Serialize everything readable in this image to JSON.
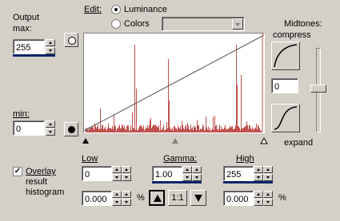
{
  "output": {
    "title_line1": "Output",
    "title_line2": "max:",
    "max_value": "255",
    "min_label": "min:",
    "min_value": "0"
  },
  "edit": {
    "label": "Edit:",
    "options": [
      "Luminance",
      "Colors"
    ],
    "selected": "Luminance",
    "colors_dropdown_value": ""
  },
  "midtones": {
    "label": "Midtones:",
    "compress_label": "compress",
    "expand_label": "expand",
    "value": "0"
  },
  "overlay": {
    "line1": "Overlay",
    "line2": "result",
    "line3": "histogram",
    "checked": true
  },
  "low": {
    "label": "Low",
    "value": "0",
    "percent": "0.000"
  },
  "gamma": {
    "label": "Gamma:",
    "value": "1.00"
  },
  "high": {
    "label": "High",
    "value": "255",
    "percent": "0.000"
  },
  "units": {
    "percent": "%"
  },
  "gamma_buttons": {
    "middle": "1:1"
  },
  "colors": {
    "histogram": "#c0504d",
    "accent": "#0a246a"
  }
}
